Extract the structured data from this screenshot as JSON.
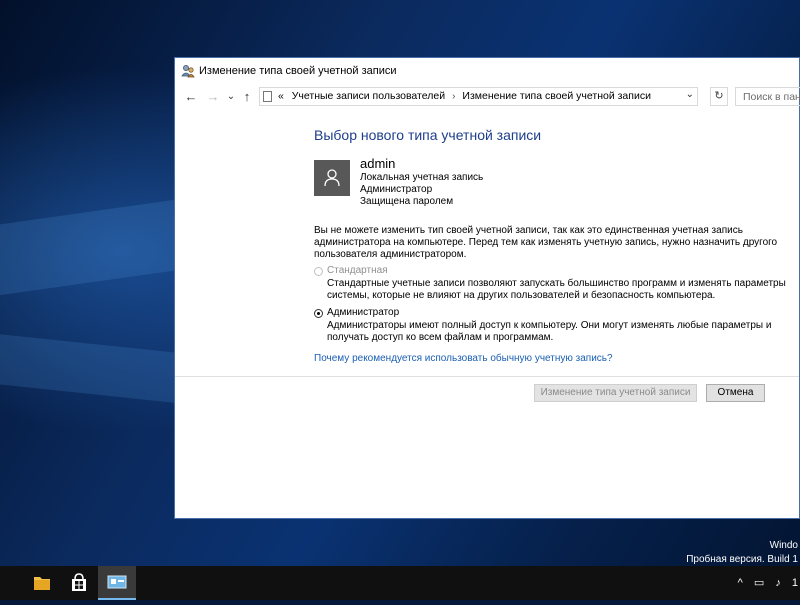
{
  "window": {
    "title": "Изменение типа своей учетной записи"
  },
  "nav": {
    "back_icon": "←",
    "forward_icon": "→",
    "recent_icon": "⌄",
    "up_icon": "↑"
  },
  "addressbar": {
    "prefix": "«",
    "crumb1": "Учетные записи пользователей",
    "separator": "›",
    "crumb2": "Изменение типа своей учетной записи",
    "dropdown_icon": "⌄"
  },
  "refresh_icon": "↻",
  "search": {
    "placeholder": "Поиск в пане"
  },
  "content": {
    "heading": "Выбор нового типа учетной записи",
    "user": {
      "name": "admin",
      "line1": "Локальная учетная запись",
      "line2": "Администратор",
      "line3": "Защищена паролем"
    },
    "warning": [
      "Вы не можете изменить тип своей учетной записи, так как это единственная учетная запись",
      "администратора на компьютере. Перед тем как изменять учетную запись, нужно назначить другого",
      "пользователя администратором."
    ],
    "option_standard": {
      "label": "Стандартная",
      "desc": [
        "Стандартные учетные записи позволяют запускать большинство программ и изменять параметры",
        "системы, которые не влияют на других пользователей и безопасность компьютера."
      ]
    },
    "option_admin": {
      "label": "Администратор",
      "desc": [
        "Администраторы имеют полный доступ к компьютеру. Они могут изменять любые параметры и",
        "получать доступ ко всем файлам и программам."
      ]
    },
    "link": "Почему рекомендуется использовать обычную учетную запись?",
    "btn_change": "Изменение типа учетной записи",
    "btn_cancel": "Отмена"
  },
  "watermark": {
    "line1": "Windo",
    "line2": "Пробная версия. Build 1"
  },
  "taskbar": {
    "tray_chevron": "^",
    "tray_sound": "♪",
    "tray_time": "1"
  },
  "colors": {
    "heading": "#1e3e8c",
    "link": "#1a5fb4",
    "taskbar": "#101010"
  }
}
